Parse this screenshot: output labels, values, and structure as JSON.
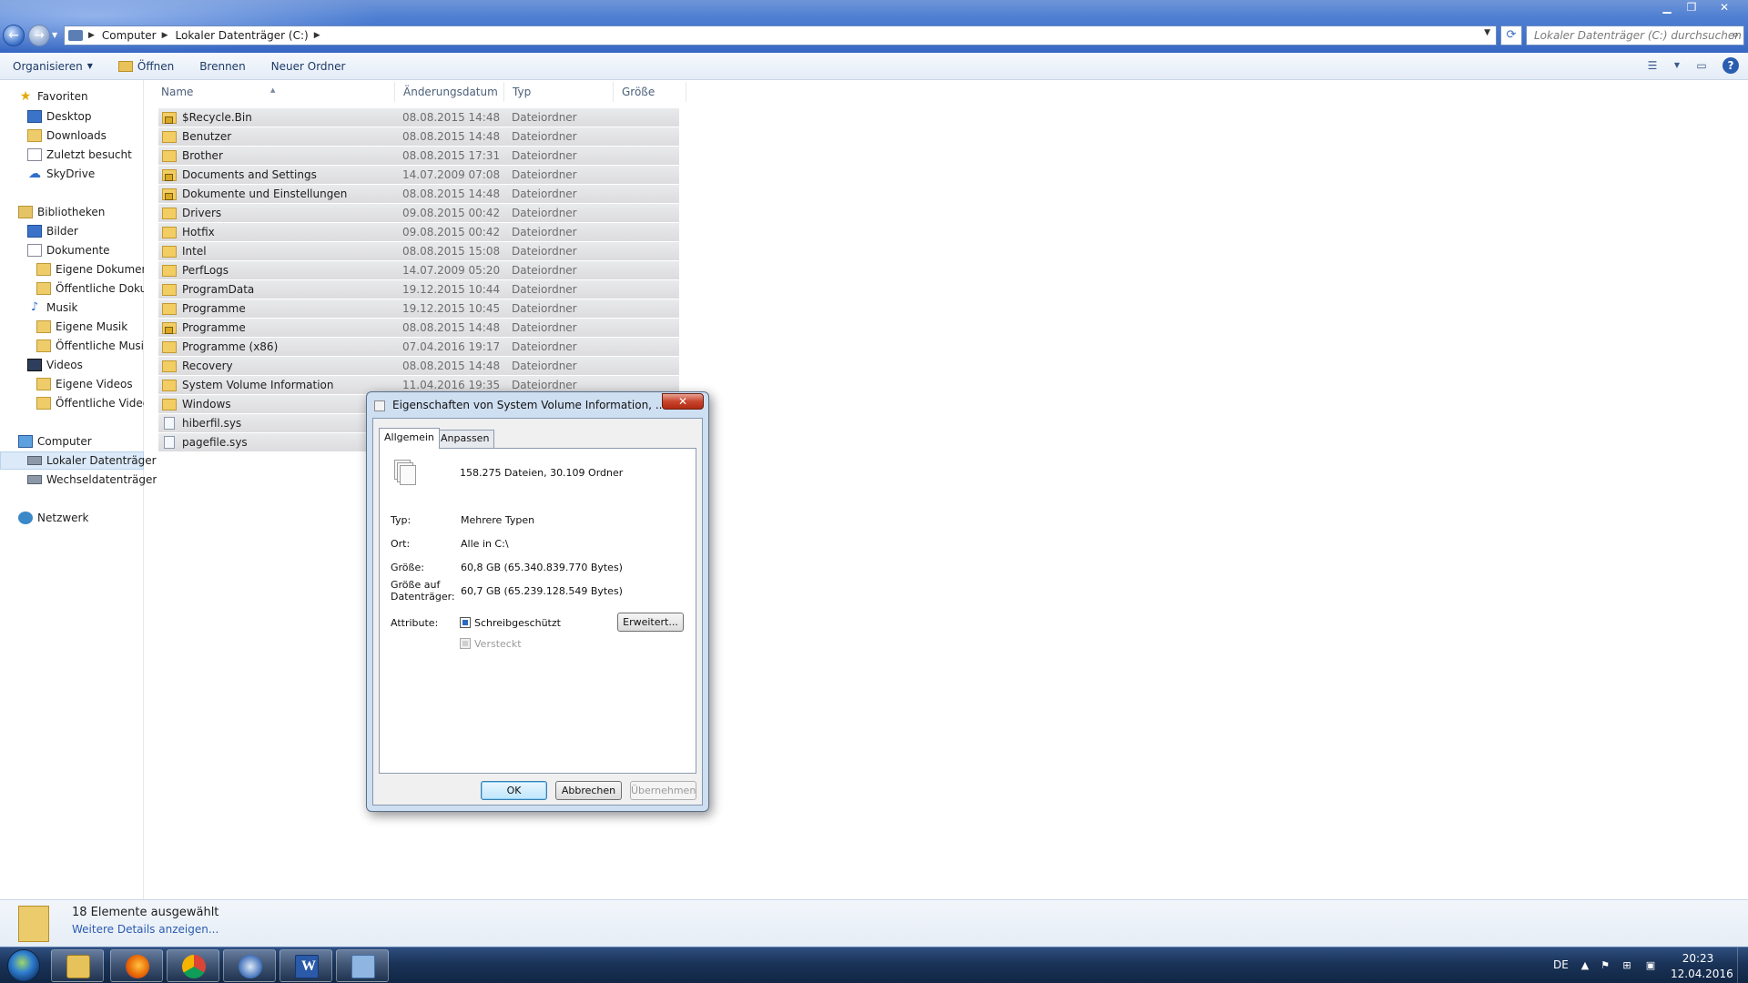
{
  "window": {
    "minimize": "▁",
    "maximize": "❐",
    "close": "✕"
  },
  "address": {
    "crumbs": [
      "Computer",
      "Lokaler Datenträger (C:)"
    ],
    "search_placeholder": "Lokaler Datenträger (C:) durchsuchen"
  },
  "toolbar": {
    "organize": "Organisieren",
    "open": "Öffnen",
    "burn": "Brennen",
    "new_folder": "Neuer Ordner"
  },
  "navigation": {
    "favorites": "Favoriten",
    "desktop": "Desktop",
    "downloads": "Downloads",
    "recent": "Zuletzt besucht",
    "skydrive": "SkyDrive",
    "libraries": "Bibliotheken",
    "pictures": "Bilder",
    "documents": "Dokumente",
    "my_documents": "Eigene Dokumente",
    "public_documents": "Öffentliche Dokumente",
    "music": "Musik",
    "my_music": "Eigene Musik",
    "public_music": "Öffentliche Musik",
    "videos": "Videos",
    "my_videos": "Eigene Videos",
    "public_videos": "Öffentliche Videos",
    "computer": "Computer",
    "local_disk": "Lokaler Datenträger",
    "removable": "Wechseldatenträger",
    "network": "Netzwerk"
  },
  "columns": {
    "name": "Name",
    "date": "Änderungsdatum",
    "type": "Typ",
    "size": "Größe"
  },
  "files": [
    {
      "name": "$Recycle.Bin",
      "date": "08.08.2015 14:48",
      "type": "Dateiordner",
      "kind": "folder-lock"
    },
    {
      "name": "Benutzer",
      "date": "08.08.2015 14:48",
      "type": "Dateiordner",
      "kind": "folder"
    },
    {
      "name": "Brother",
      "date": "08.08.2015 17:31",
      "type": "Dateiordner",
      "kind": "folder"
    },
    {
      "name": "Documents and Settings",
      "date": "14.07.2009 07:08",
      "type": "Dateiordner",
      "kind": "folder-lock"
    },
    {
      "name": "Dokumente und Einstellungen",
      "date": "08.08.2015 14:48",
      "type": "Dateiordner",
      "kind": "folder-lock"
    },
    {
      "name": "Drivers",
      "date": "09.08.2015 00:42",
      "type": "Dateiordner",
      "kind": "folder"
    },
    {
      "name": "Hotfix",
      "date": "09.08.2015 00:42",
      "type": "Dateiordner",
      "kind": "folder"
    },
    {
      "name": "Intel",
      "date": "08.08.2015 15:08",
      "type": "Dateiordner",
      "kind": "folder"
    },
    {
      "name": "PerfLogs",
      "date": "14.07.2009 05:20",
      "type": "Dateiordner",
      "kind": "folder"
    },
    {
      "name": "ProgramData",
      "date": "19.12.2015 10:44",
      "type": "Dateiordner",
      "kind": "folder"
    },
    {
      "name": "Programme",
      "date": "19.12.2015 10:45",
      "type": "Dateiordner",
      "kind": "folder"
    },
    {
      "name": "Programme",
      "date": "08.08.2015 14:48",
      "type": "Dateiordner",
      "kind": "folder-lock"
    },
    {
      "name": "Programme (x86)",
      "date": "07.04.2016 19:17",
      "type": "Dateiordner",
      "kind": "folder"
    },
    {
      "name": "Recovery",
      "date": "08.08.2015 14:48",
      "type": "Dateiordner",
      "kind": "folder"
    },
    {
      "name": "System Volume Information",
      "date": "11.04.2016 19:35",
      "type": "Dateiordner",
      "kind": "folder"
    },
    {
      "name": "Windows",
      "date": "",
      "type": "",
      "kind": "folder"
    },
    {
      "name": "hiberfil.sys",
      "date": "",
      "type": "",
      "kind": "sysfile"
    },
    {
      "name": "pagefile.sys",
      "date": "",
      "type": "",
      "kind": "sysfile"
    }
  ],
  "status": {
    "count": "18 Elemente ausgewählt",
    "details": "Weitere Details anzeigen..."
  },
  "dialog": {
    "title": "Eigenschaften von System Volume Information, ...",
    "tab_general": "Allgemein",
    "tab_customize": "Anpassen",
    "summary": "158.275 Dateien, 30.109 Ordner",
    "type_label": "Typ:",
    "type_value": "Mehrere Typen",
    "location_label": "Ort:",
    "location_value": "Alle in C:\\",
    "size_label": "Größe:",
    "size_value": "60,8 GB (65.340.839.770 Bytes)",
    "disk_size_label_1": "Größe auf",
    "disk_size_label_2": "Datenträger:",
    "disk_size_value": "60,7 GB (65.239.128.549 Bytes)",
    "attributes_label": "Attribute:",
    "readonly": "Schreibgeschützt",
    "hidden": "Versteckt",
    "advanced": "Erweitert...",
    "ok": "OK",
    "cancel": "Abbrechen",
    "apply": "Übernehmen"
  },
  "taskbar": {
    "language": "DE",
    "time": "20:23",
    "date": "12.04.2016"
  }
}
